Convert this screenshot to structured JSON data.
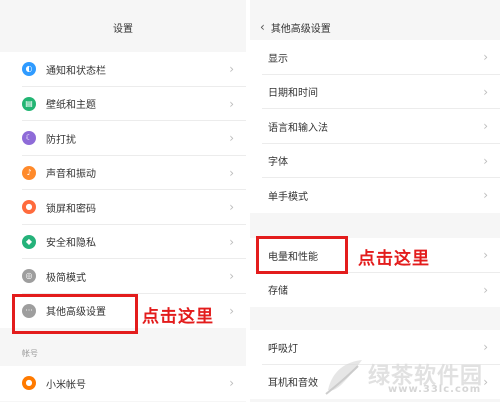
{
  "left_panel": {
    "title": "设置",
    "items": [
      {
        "label": "通知和状态栏",
        "icon": "notification-toggle-icon",
        "color": "#2f9bff"
      },
      {
        "label": "壁纸和主题",
        "icon": "wallpaper-icon",
        "color": "#22b573"
      },
      {
        "label": "防打扰",
        "icon": "moon-icon",
        "color": "#8e6bd8"
      },
      {
        "label": "声音和振动",
        "icon": "sound-icon",
        "color": "#ff8a2b"
      },
      {
        "label": "锁屏和密码",
        "icon": "lock-icon",
        "color": "#ff6b3d"
      },
      {
        "label": "安全和隐私",
        "icon": "shield-icon",
        "color": "#25b27a"
      },
      {
        "label": "极简模式",
        "icon": "minimal-mode-icon",
        "color": "#9e9e9e"
      },
      {
        "label": "其他高级设置",
        "icon": "more-icon",
        "color": "#9e9e9e"
      }
    ],
    "section_label": "帐号",
    "account_items": [
      {
        "label": "小米帐号",
        "icon": "mi-account-icon",
        "color": "#ff7a00"
      }
    ]
  },
  "right_panel": {
    "title": "其他高级设置",
    "back_icon": "chevron-left-icon",
    "group1": [
      {
        "label": "显示"
      },
      {
        "label": "日期和时间"
      },
      {
        "label": "语言和输入法"
      },
      {
        "label": "字体"
      },
      {
        "label": "单手模式"
      }
    ],
    "group2": [
      {
        "label": "电量和性能"
      },
      {
        "label": "存储"
      }
    ],
    "group3": [
      {
        "label": "呼吸灯"
      },
      {
        "label": "耳机和音效"
      }
    ]
  },
  "annotations": {
    "left_callout": "点击这里",
    "right_callout": "点击这里",
    "highlight_color": "#e31c1c"
  },
  "watermark": {
    "brand": "绿茶软件园",
    "url": "www.33lc.com"
  }
}
